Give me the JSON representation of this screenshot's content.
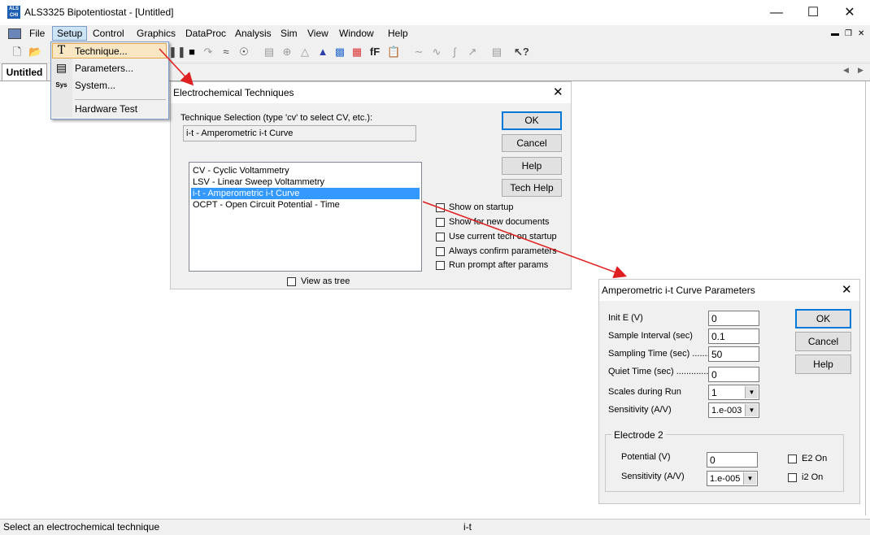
{
  "window": {
    "title": "ALS3325 Bipotentiostat - [Untitled]",
    "icon_text": "ALS CHI"
  },
  "menubar": {
    "items": [
      "File",
      "Setup",
      "Control",
      "Graphics",
      "DataProc",
      "Analysis",
      "Sim",
      "View",
      "Window",
      "Help"
    ]
  },
  "document": {
    "tab_label": "Untitled"
  },
  "setup_menu": {
    "items": [
      {
        "label": "Technique...",
        "icon": "technique-icon"
      },
      {
        "label": "Parameters...",
        "icon": "parameters-icon"
      },
      {
        "label": "System...",
        "icon": "system-icon"
      },
      {
        "label": "Hardware Test",
        "icon": ""
      }
    ]
  },
  "tech_dialog": {
    "title": "Electrochemical Techniques",
    "selection_label": "Technique Selection (type 'cv' to select CV, etc.):",
    "selection_value": "i-t - Amperometric i-t Curve",
    "list": [
      "CV - Cyclic Voltammetry",
      "LSV - Linear Sweep Voltammetry",
      "i-t - Amperometric i-t Curve",
      "OCPT - Open Circuit Potential - Time"
    ],
    "selected_index": 2,
    "buttons": {
      "ok": "OK",
      "cancel": "Cancel",
      "help": "Help",
      "tech_help": "Tech Help"
    },
    "options": [
      "Show on startup",
      "Show for new documents",
      "Use current tech on startup",
      "Always confirm parameters",
      "Run prompt after params"
    ],
    "view_as_tree": "View as tree"
  },
  "params_dialog": {
    "title": "Amperometric i-t Curve Parameters",
    "fields": [
      {
        "label": "Init E (V)",
        "value": "0"
      },
      {
        "label": "Sample Interval (sec)",
        "value": "0.1"
      },
      {
        "label": "Sampling Time (sec) ........",
        "value": "50"
      },
      {
        "label": "Quiet Time (sec) ..............",
        "value": "0"
      }
    ],
    "scales_label": "Scales during Run",
    "scales_value": "1",
    "sensitivity_label": "Sensitivity (A/V)",
    "sensitivity_value": "1.e-003",
    "electrode2": {
      "group_label": "Electrode 2",
      "potential_label": "Potential (V)",
      "potential_value": "0",
      "sensitivity_label": "Sensitivity (A/V)",
      "sensitivity_value": "1.e-005",
      "e2_on": "E2 On",
      "i2_on": "i2 On"
    },
    "buttons": {
      "ok": "OK",
      "cancel": "Cancel",
      "help": "Help"
    }
  },
  "statusbar": {
    "message": "Select an electrochemical technique",
    "technique": "i-t"
  },
  "colors": {
    "selection": "#3399ff",
    "arrow": "#e02020",
    "default_button_border": "#0078d7"
  }
}
